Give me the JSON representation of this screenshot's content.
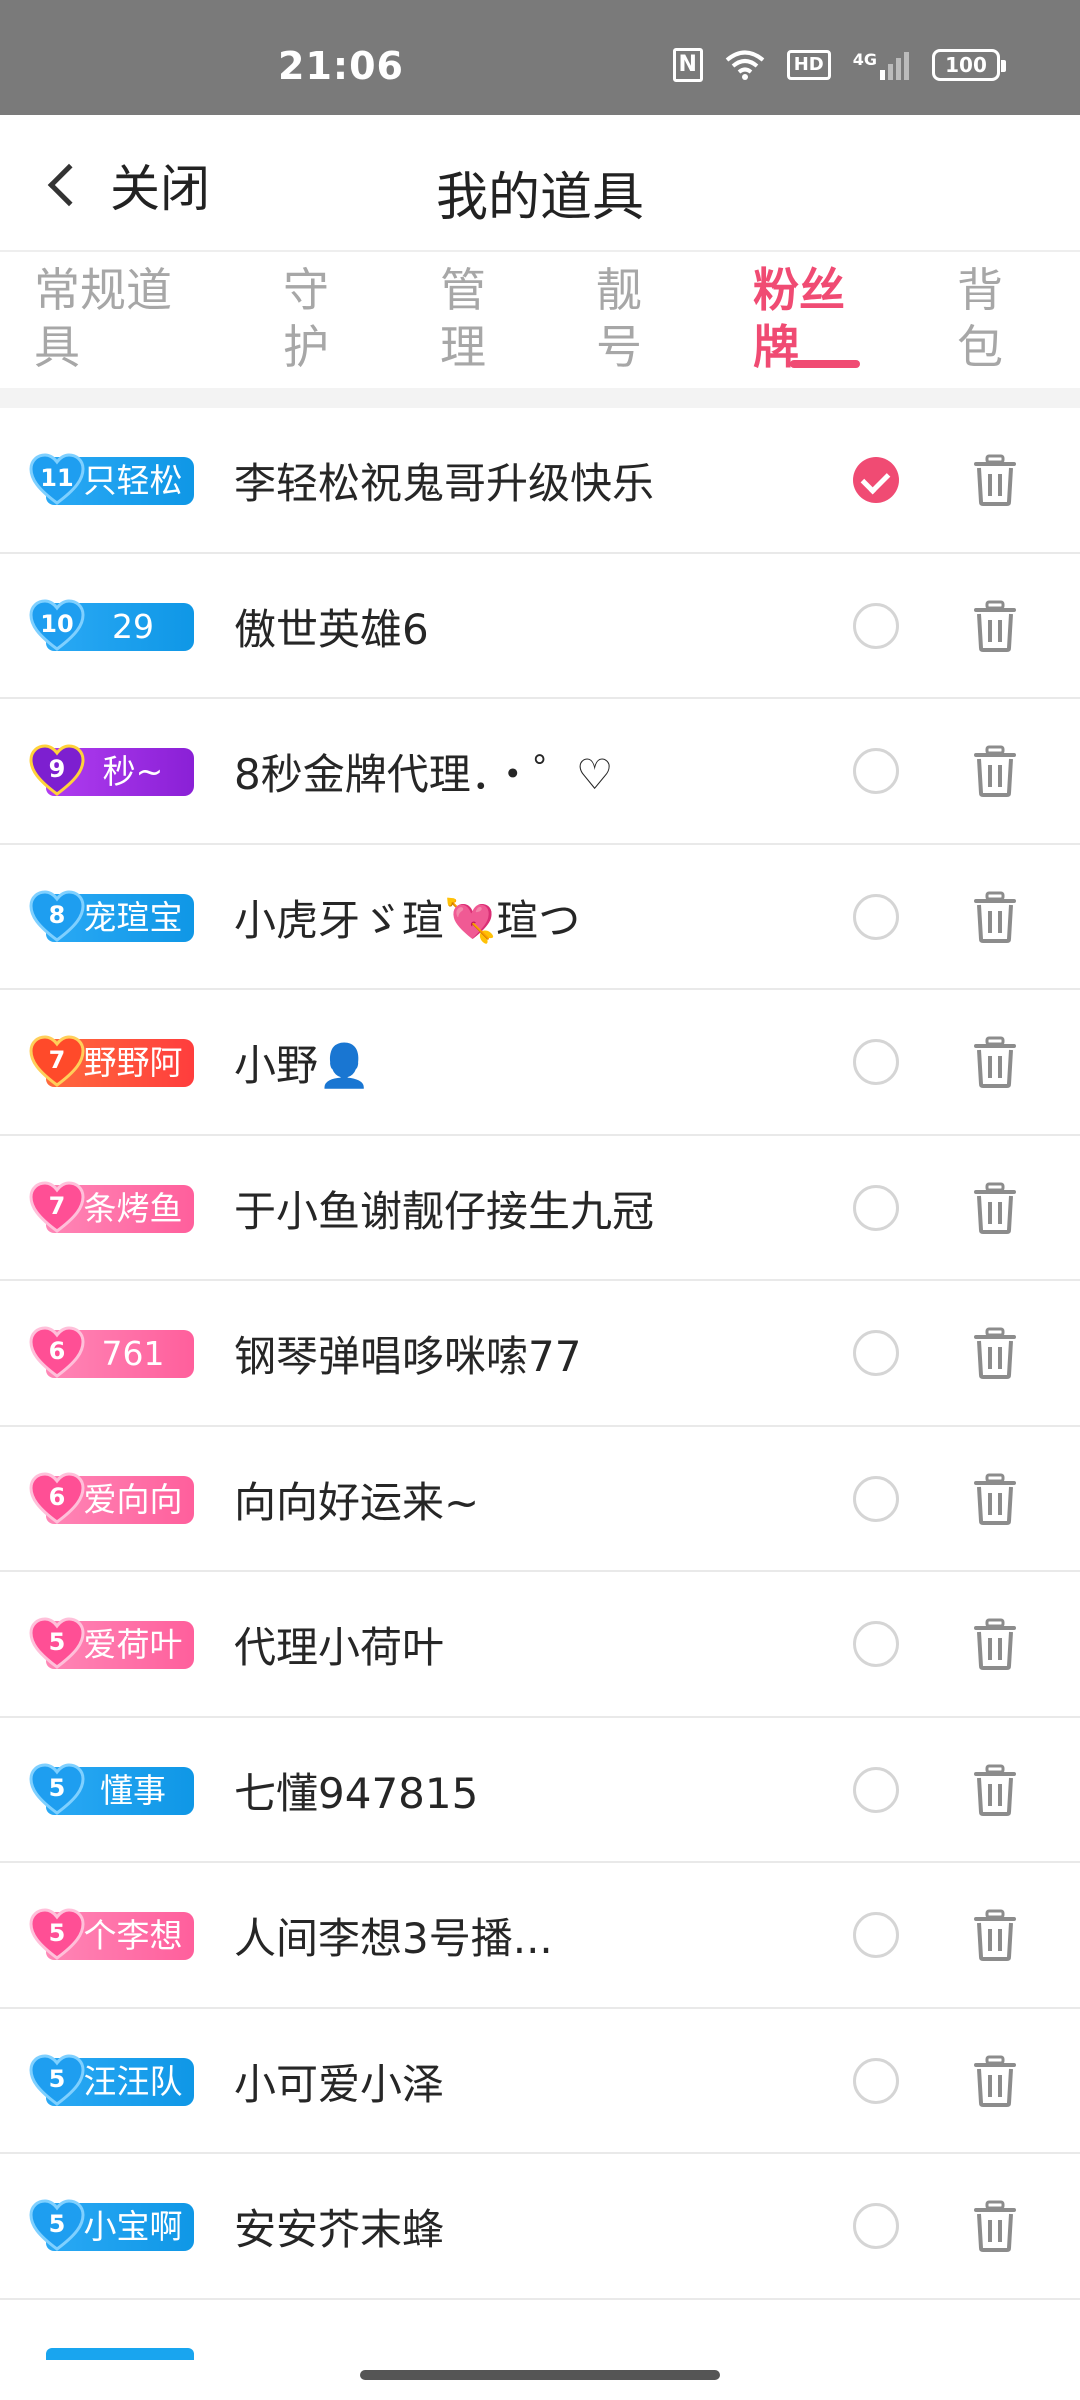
{
  "status_bar": {
    "time": "21:06",
    "nfc": "N",
    "hd": "HD",
    "network": "4G",
    "battery": "100"
  },
  "nav": {
    "back_label": "关闭",
    "title": "我的道具"
  },
  "tabs": [
    {
      "label_line1": "常规道",
      "label_line2": "具",
      "active": false
    },
    {
      "label_line1": "守",
      "label_line2": "护",
      "active": false
    },
    {
      "label_line1": "管",
      "label_line2": "理",
      "active": false
    },
    {
      "label_line1": "靓",
      "label_line2": "号",
      "active": false
    },
    {
      "label_line1": "粉丝",
      "label_line2": "牌",
      "active": true
    },
    {
      "label_line1": "背",
      "label_line2": "包",
      "active": false
    }
  ],
  "colors": {
    "accent": "#f04b73",
    "blue_badge": "#19a5ef",
    "pink_badge": "#ff73a8",
    "orange_badge": "#ff5e3a",
    "purple_badge": "#9b2de0"
  },
  "items": [
    {
      "level": "11",
      "badge_text": "只轻松",
      "badge_style": "blue",
      "name": "李轻松祝鬼哥升级快乐",
      "selected": true
    },
    {
      "level": "10",
      "badge_text": "29",
      "badge_style": "blue",
      "name": "傲世英雄6",
      "selected": false
    },
    {
      "level": "9",
      "badge_text": "秒~",
      "badge_style": "purple",
      "name": "8秒金牌代理．・゜♡",
      "selected": false
    },
    {
      "level": "8",
      "badge_text": "宠瑄宝",
      "badge_style": "blue",
      "name": "小虎牙ゞ瑄💘瑄つ",
      "selected": false
    },
    {
      "level": "7",
      "badge_text": "野野阿",
      "badge_style": "orange",
      "name": "小野👤",
      "selected": false
    },
    {
      "level": "7",
      "badge_text": "条烤鱼",
      "badge_style": "pink",
      "name": "于小鱼谢靓仔接生九冠",
      "selected": false
    },
    {
      "level": "6",
      "badge_text": "761",
      "badge_style": "pink",
      "name": "钢琴弹唱哆咪嗦77",
      "selected": false
    },
    {
      "level": "6",
      "badge_text": "爱向向",
      "badge_style": "pink",
      "name": "向向好运来~",
      "selected": false
    },
    {
      "level": "5",
      "badge_text": "爱荷叶",
      "badge_style": "pink",
      "name": "代理小荷叶",
      "selected": false
    },
    {
      "level": "5",
      "badge_text": "懂事",
      "badge_style": "blue",
      "name": "七懂947815",
      "selected": false
    },
    {
      "level": "5",
      "badge_text": "个李想",
      "badge_style": "pink",
      "name": "人间李想3号播...",
      "selected": false
    },
    {
      "level": "5",
      "badge_text": "汪汪队",
      "badge_style": "blue",
      "name": "小可爱小泽",
      "selected": false
    },
    {
      "level": "5",
      "badge_text": "小宝啊",
      "badge_style": "blue",
      "name": "安安芥末蜂",
      "selected": false
    }
  ]
}
